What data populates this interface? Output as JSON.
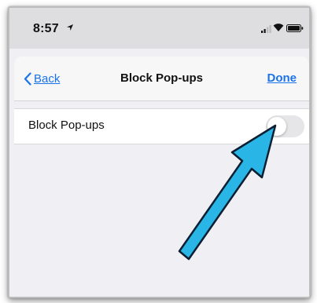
{
  "status_bar": {
    "time": "8:57",
    "icons": [
      "location-icon",
      "signal-icon",
      "wifi-icon",
      "battery-icon"
    ]
  },
  "nav": {
    "back_label": "Back",
    "title": "Block Pop-ups",
    "done_label": "Done"
  },
  "settings": {
    "block_popups": {
      "label": "Block Pop-ups",
      "enabled": false
    }
  },
  "colors": {
    "accent": "#1a73e8",
    "arrow_fill": "#29b6e6",
    "arrow_outline": "#0b1f33",
    "background": "#efeff4"
  }
}
